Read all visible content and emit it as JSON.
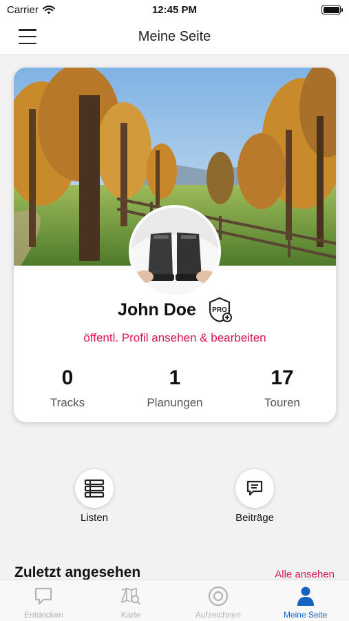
{
  "status_bar": {
    "carrier": "Carrier",
    "time": "12:45 PM"
  },
  "nav": {
    "title": "Meine Seite"
  },
  "profile": {
    "name": "John Doe",
    "badge_icon": "pro-badge-icon",
    "link": "öffentl. Profil ansehen & bearbeiten",
    "stats": [
      {
        "value": "0",
        "label": "Tracks"
      },
      {
        "value": "1",
        "label": "Planungen"
      },
      {
        "value": "17",
        "label": "Touren"
      }
    ]
  },
  "actions": [
    {
      "label": "Listen",
      "icon": "list-icon"
    },
    {
      "label": "Beiträge",
      "icon": "message-icon"
    }
  ],
  "recent": {
    "title": "Zuletzt angesehen",
    "see_all": "Alle ansehen"
  },
  "tabs": [
    {
      "label": "Entdecken",
      "icon": "chat-bubble-icon",
      "active": false
    },
    {
      "label": "Karte",
      "icon": "map-search-icon",
      "active": false
    },
    {
      "label": "Aufzeichnen",
      "icon": "record-icon",
      "active": false
    },
    {
      "label": "Meine Seite",
      "icon": "person-icon",
      "active": true
    }
  ],
  "colors": {
    "accent": "#d8174f",
    "active_tab": "#1565c0",
    "inactive_tab": "#b4b4b4"
  }
}
